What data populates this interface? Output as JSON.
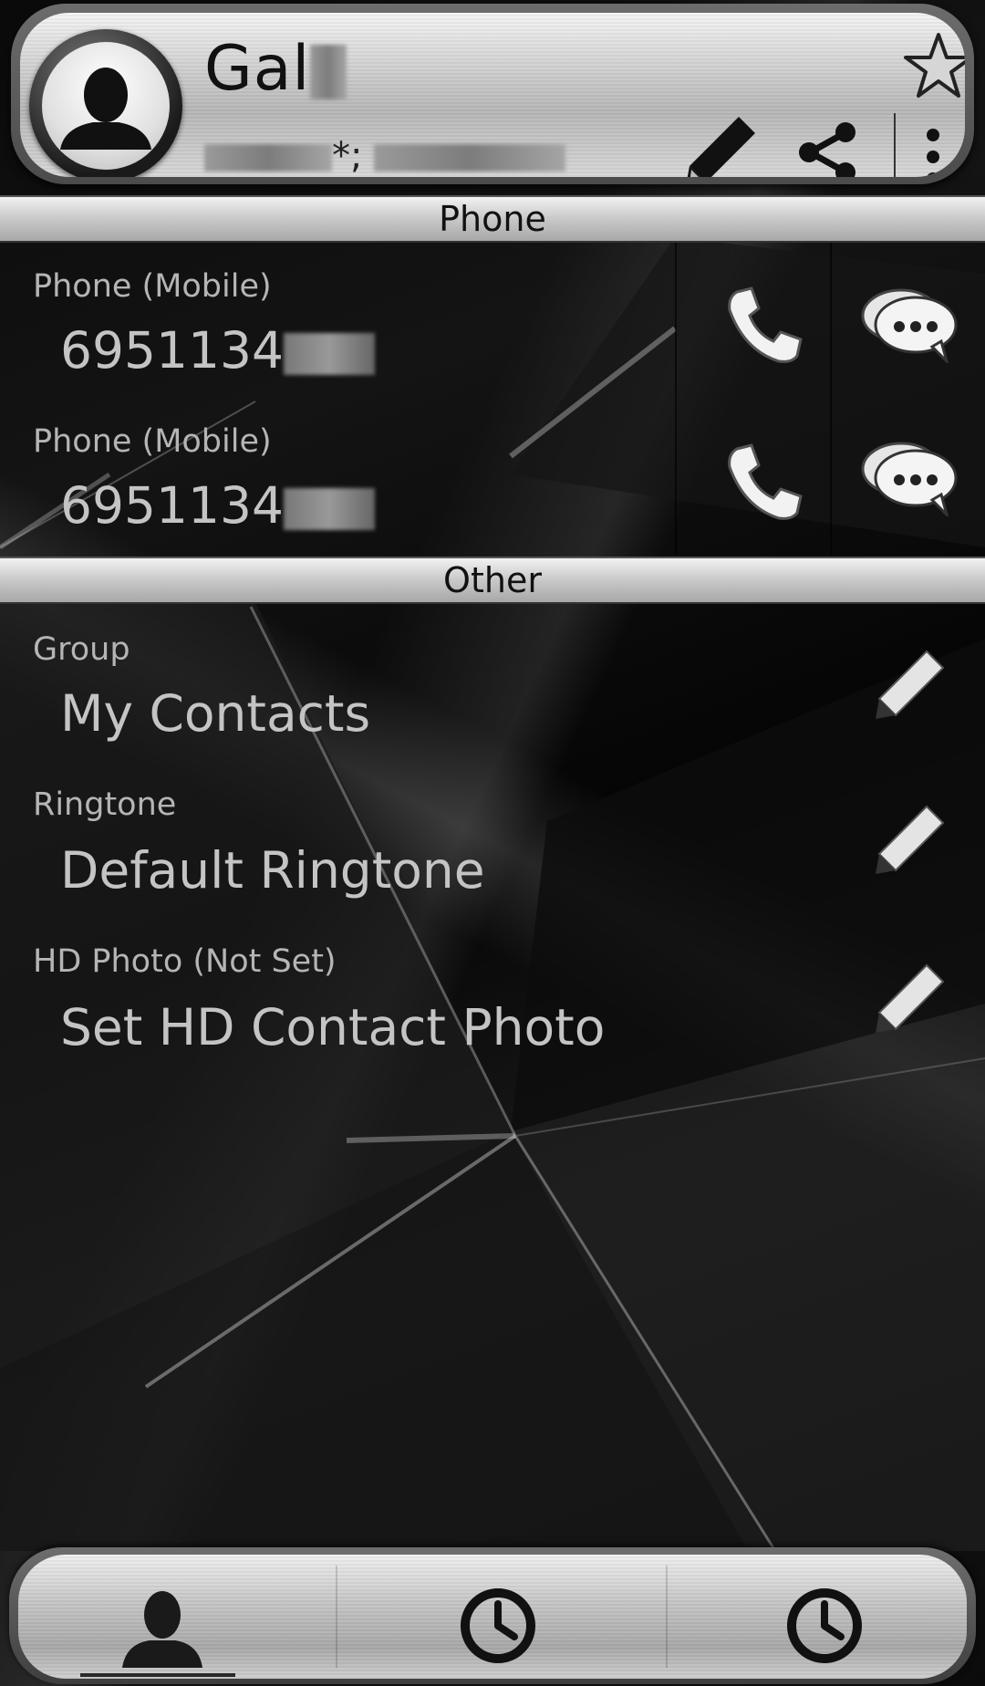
{
  "header": {
    "name_visible": "Gal",
    "subtitle_mid": "*;",
    "icons": [
      "avatar-silhouette-icon",
      "star-icon",
      "pencil-icon",
      "share-icon",
      "overflow-menu-icon"
    ]
  },
  "sections": {
    "phone": "Phone",
    "other": "Other"
  },
  "phones": [
    {
      "label": "Phone  (Mobile)",
      "number_visible": "6951134"
    },
    {
      "label": "Phone  (Mobile)",
      "number_visible": "6951134"
    }
  ],
  "other_rows": [
    {
      "label": "Group",
      "value": "My Contacts"
    },
    {
      "label": "Ringtone",
      "value": "Default Ringtone"
    },
    {
      "label": "HD Photo (Not Set)",
      "value": "Set HD Contact Photo"
    }
  ],
  "bottom_nav": {
    "tabs": [
      "contacts-tab",
      "recent-calls-tab",
      "call-log-tab"
    ],
    "selected": "contacts-tab"
  },
  "colors": {
    "text_light": "#c4c4c4",
    "label_light": "#b5b5b5",
    "metal_light": "#e8e8e8",
    "metal_dark": "#9a9a9a"
  }
}
